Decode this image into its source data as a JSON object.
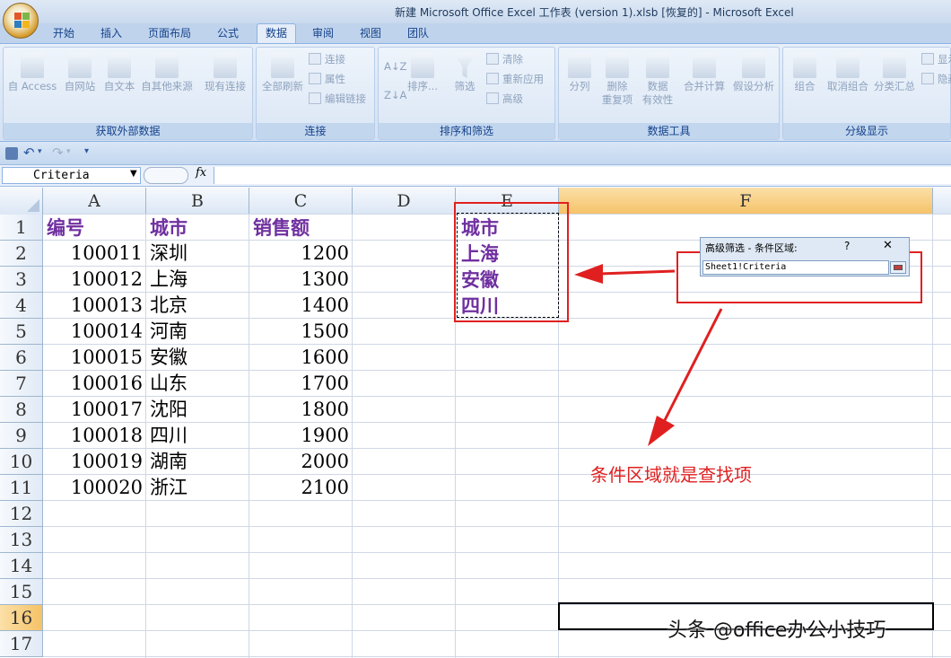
{
  "window": {
    "title": "新建 Microsoft Office Excel 工作表 (version 1).xlsb [恢复的] - Microsoft Excel"
  },
  "tabs": [
    "开始",
    "插入",
    "页面布局",
    "公式",
    "数据",
    "审阅",
    "视图",
    "团队"
  ],
  "active_tab": "数据",
  "ribbon": {
    "groups": {
      "external": "获取外部数据",
      "connections": "连接",
      "sortfilter": "排序和筛选",
      "datatools": "数据工具",
      "outline": "分级显示"
    },
    "buttons": {
      "access": "自 Access",
      "web": "自网站",
      "text": "自文本",
      "other": "自其他来源",
      "existing": "现有连接",
      "refresh_all": "全部刷新",
      "connections": "连接",
      "properties": "属性",
      "edit_links": "编辑链接",
      "sort": "排序...",
      "filter": "筛选",
      "clear": "清除",
      "reapply": "重新应用",
      "advanced": "高级",
      "text_to_columns": "分列",
      "remove_dup_1": "删除",
      "remove_dup_2": "重复项",
      "validation_1": "数据",
      "validation_2": "有效性",
      "consolidate": "合并计算",
      "whatif": "假设分析",
      "group": "组合",
      "ungroup": "取消组合",
      "subtotal": "分类汇总",
      "show": "显示",
      "hide": "隐藏"
    }
  },
  "namebox": "Criteria",
  "fx": "fx",
  "columns": [
    "A",
    "B",
    "C",
    "D",
    "E",
    "F"
  ],
  "rows": [
    "1",
    "2",
    "3",
    "4",
    "5",
    "6",
    "7",
    "8",
    "9",
    "10",
    "11",
    "12",
    "13",
    "14",
    "15",
    "16",
    "17"
  ],
  "table": {
    "headers": [
      "编号",
      "城市",
      "销售额"
    ],
    "rows": [
      [
        "100011",
        "深圳",
        "1200"
      ],
      [
        "100012",
        "上海",
        "1300"
      ],
      [
        "100013",
        "北京",
        "1400"
      ],
      [
        "100014",
        "河南",
        "1500"
      ],
      [
        "100015",
        "安徽",
        "1600"
      ],
      [
        "100016",
        "山东",
        "1700"
      ],
      [
        "100017",
        "沈阳",
        "1800"
      ],
      [
        "100018",
        "四川",
        "1900"
      ],
      [
        "100019",
        "湖南",
        "2000"
      ],
      [
        "100020",
        "浙江",
        "2100"
      ]
    ]
  },
  "criteria": [
    "城市",
    "上海",
    "安徽",
    "四川"
  ],
  "dialog": {
    "title": "高级筛选 - 条件区域:",
    "help": "?",
    "close": "✕",
    "value": "Sheet1!Criteria"
  },
  "annotation": "条件区域就是查找项",
  "watermark": "头条 @office办公小技巧",
  "colors": {
    "header_text": "#7030a0",
    "red_box": "#e02020",
    "selected_col": "#f5c266"
  }
}
